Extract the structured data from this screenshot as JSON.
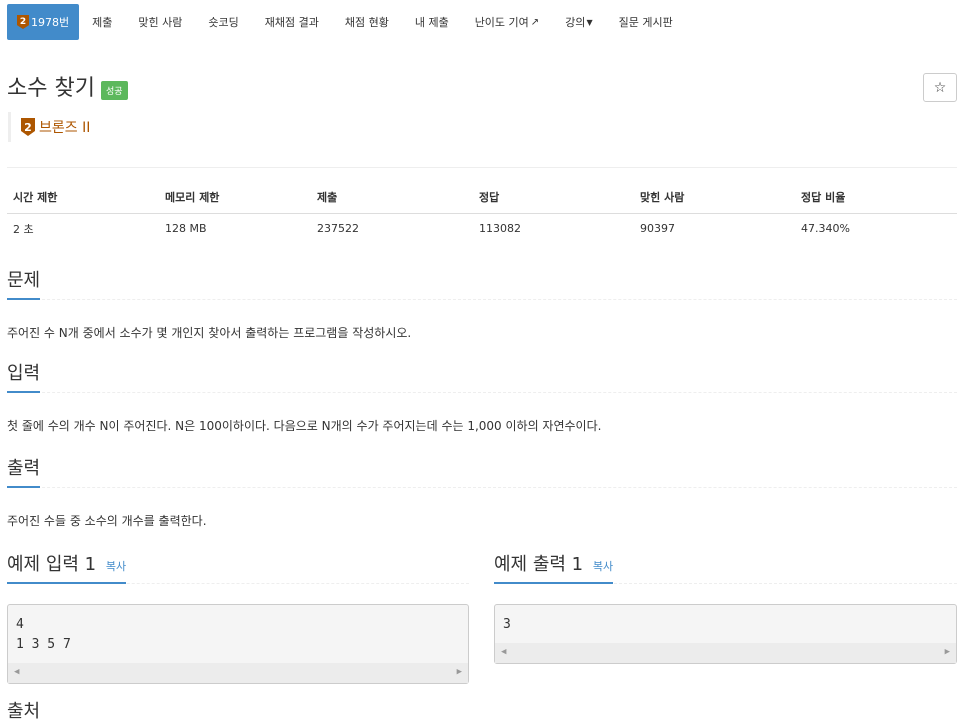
{
  "nav": {
    "problem_number": "1978번",
    "tier_number": "2",
    "items": [
      "제출",
      "맞힌 사람",
      "숏코딩",
      "재채점 결과",
      "채점 현황",
      "내 제출",
      "난이도 기여",
      "강의",
      "질문 게시판"
    ]
  },
  "problem": {
    "title": "소수 찾기",
    "status_label": "성공",
    "star_icon": "☆",
    "tier_badge": "2",
    "tier_name": "브론즈 II"
  },
  "info": {
    "headers": [
      "시간 제한",
      "메모리 제한",
      "제출",
      "정답",
      "맞힌 사람",
      "정답 비율"
    ],
    "values": [
      "2 초",
      "128 MB",
      "237522",
      "113082",
      "90397",
      "47.340%"
    ]
  },
  "sections": {
    "description": {
      "heading": "문제",
      "text": "주어진 수 N개 중에서 소수가 몇 개인지 찾아서 출력하는 프로그램을 작성하시오."
    },
    "input": {
      "heading": "입력",
      "text": "첫 줄에 수의 개수 N이 주어진다. N은 100이하이다. 다음으로 N개의 수가 주어지는데 수는 1,000 이하의 자연수이다."
    },
    "output": {
      "heading": "출력",
      "text": "주어진 수들 중 소수의 개수를 출력한다."
    },
    "source": {
      "heading": "출처"
    }
  },
  "samples": {
    "input": {
      "label": "예제 입력 1",
      "copy": "복사",
      "content": "4\n1 3 5 7"
    },
    "output": {
      "label": "예제 출력 1",
      "copy": "복사",
      "content": "3"
    }
  },
  "colors": {
    "accent": "#428bca",
    "success": "#5cb85c",
    "bronze": "#ad5600"
  }
}
